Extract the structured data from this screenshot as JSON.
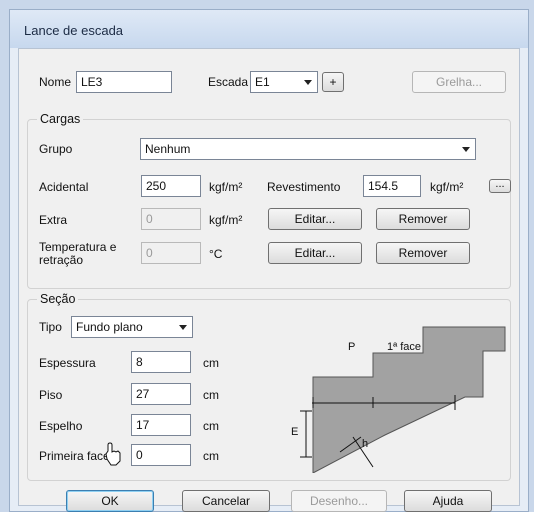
{
  "window": {
    "title": "Lance de escada"
  },
  "top": {
    "nome_label": "Nome",
    "nome_value": "LE3",
    "escada_label": "Escada",
    "escada_value": "E1",
    "add_label": "+",
    "grelha_label": "Grelha..."
  },
  "cargas": {
    "title": "Cargas",
    "grupo_label": "Grupo",
    "grupo_value": "Nenhum",
    "acidental_label": "Acidental",
    "acidental_value": "250",
    "acidental_unit": "kgf/m²",
    "revest_label": "Revestimento",
    "revest_value": "154.5",
    "revest_unit": "kgf/m²",
    "revest_btn": "...",
    "extra_label": "Extra",
    "extra_value": "0",
    "extra_unit": "kgf/m²",
    "editar1": "Editar...",
    "remover1": "Remover",
    "temp_label_1": "Temperatura e",
    "temp_label_2": "retração",
    "temp_value": "0",
    "temp_unit": "°C",
    "editar2": "Editar...",
    "remover2": "Remover"
  },
  "secao": {
    "title": "Seção",
    "tipo_label": "Tipo",
    "tipo_value": "Fundo plano",
    "espessura_label": "Espessura",
    "espessura_value": "8",
    "espessura_unit": "cm",
    "piso_label": "Piso",
    "piso_value": "27",
    "piso_unit": "cm",
    "espelho_label": "Espelho",
    "espelho_value": "17",
    "espelho_unit": "cm",
    "primeira_label": "Primeira face",
    "primeira_value": "0",
    "primeira_unit": "cm",
    "diagram": {
      "p": "P",
      "face": "1ª face",
      "e": "E",
      "h": "h"
    }
  },
  "buttons": {
    "ok": "OK",
    "cancelar": "Cancelar",
    "desenho": "Desenho...",
    "ajuda": "Ajuda"
  }
}
